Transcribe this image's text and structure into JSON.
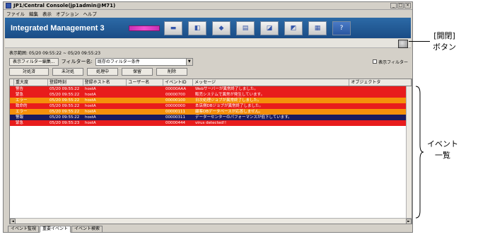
{
  "window": {
    "title": "JP1/Central Console(jp1admin@M71)",
    "controls": [
      "_",
      "□",
      "×"
    ]
  },
  "menu": [
    "ファイル",
    "編集",
    "表示",
    "オプション",
    "ヘルプ"
  ],
  "banner": {
    "title": "Integrated Management 3",
    "icons": [
      "monitor-icon",
      "document-icon",
      "diamond-icon",
      "sheet-icon",
      "folder-icon",
      "chart-icon",
      "window-icon",
      "help-icon"
    ],
    "help_label": "?"
  },
  "display_range": "表示範囲: 05/20 09:55:22 ~ 05/20 09:55:23",
  "filter": {
    "edit_button": "表示フィルター編集...",
    "name_label": "フィルター名:",
    "selected": "既存のフィルター条件",
    "toggle_label": "表示フィルター"
  },
  "actions": [
    "対処済",
    "未対処",
    "処理中",
    "保留",
    "削除"
  ],
  "table": {
    "columns": [
      "重大度",
      "登録時刻",
      "登録ホスト名",
      "ユーザー名",
      "イベントID",
      "メッセージ",
      "オブジェクトタ"
    ],
    "rows": [
      {
        "color": "red",
        "severity": "警告",
        "time": "05/20 09:55:22",
        "host": "hostA",
        "user": "",
        "event_id": "00000AAA",
        "message": "Webサーバーが異常終了しました。"
      },
      {
        "color": "red",
        "severity": "緊急",
        "time": "05/20 09:55:22",
        "host": "hostA",
        "user": "",
        "event_id": "00000700",
        "message": "販売システムで異常が発生しています。"
      },
      {
        "color": "orange",
        "severity": "エラー",
        "time": "05/20 09:55:22",
        "host": "hostA",
        "user": "",
        "event_id": "00000100",
        "message": "日次処理ジョブが異常終了しました。"
      },
      {
        "color": "red",
        "severity": "致命的",
        "time": "05/20 09:55:22",
        "host": "hostA",
        "user": "",
        "event_id": "00000000",
        "message": "本店側DBジョブが異常終了しました。"
      },
      {
        "color": "orange",
        "severity": "エラー",
        "time": "05/20 09:55:22",
        "host": "hostA",
        "user": "",
        "event_id": "00000111",
        "message": "顧客DBデータベースが応答しません。"
      },
      {
        "color": "navy",
        "severity": "警報",
        "time": "05/20 09:55:22",
        "host": "hostA",
        "user": "",
        "event_id": "00000311",
        "message": "データーセンターのパフォーマンスが低下しています。"
      },
      {
        "color": "red",
        "severity": "緊急",
        "time": "05/20 09:55:23",
        "host": "hostA",
        "user": "",
        "event_id": "00000444",
        "message": "virus detected!!"
      }
    ]
  },
  "tabs": [
    "イベント監視",
    "重要イベント",
    "イベント検索"
  ],
  "annotations": {
    "open_close": "[開閉]\nボタン",
    "event_list": "イベント\n一覧"
  },
  "colors": {
    "banner": "#1a4c86",
    "red": "#e81c1c",
    "orange": "#f5900a",
    "navy": "#1a1a5e"
  }
}
